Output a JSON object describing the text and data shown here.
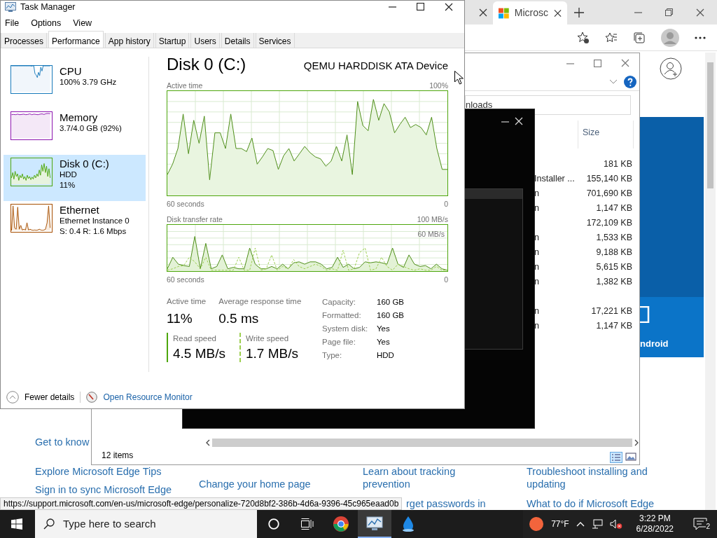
{
  "browser": {
    "tabs": [
      {
        "selected": false
      },
      {
        "title": "Microsc",
        "selected": true
      }
    ],
    "page_links": [
      {
        "lines": [
          "Get to know"
        ]
      },
      {
        "lines": [
          "Explore Microsoft Edge Tips"
        ]
      },
      {
        "lines": [
          "Sign in to sync Microsoft Edge"
        ]
      },
      {
        "lines": [
          "Change your home page"
        ]
      },
      {
        "lines": [
          "Learn about tracking",
          "prevention"
        ]
      },
      {
        "lines": [
          "rget passwords in"
        ]
      },
      {
        "lines": [
          "Troubleshoot installing and",
          "updating"
        ]
      },
      {
        "lines": [
          "What to do if Microsoft Edge"
        ]
      }
    ],
    "promo_text": "ndroid",
    "status_url": "https://support.microsoft.com/en-us/microsoft-edge/personalize-720d8bf2-386b-4d6a-9396-45c965eaad0b"
  },
  "explorer": {
    "address": "nloads",
    "size_header": "Size",
    "rows": [
      {
        "size": "181 KB"
      },
      {
        "name": "Installer ...",
        "size": "155,140 KB"
      },
      {
        "name": "n",
        "size": "701,690 KB"
      },
      {
        "name": "n",
        "size": "1,147 KB"
      },
      {
        "size": "172,109 KB"
      },
      {
        "name": "n",
        "size": "1,533 KB"
      },
      {
        "name": "n",
        "size": "9,188 KB"
      },
      {
        "name": "n",
        "size": "5,615 KB"
      },
      {
        "name": "n",
        "size": "1,382 KB"
      },
      {},
      {
        "name": "n",
        "size": "17,221 KB"
      },
      {
        "name": "n",
        "size": "1,147 KB"
      }
    ],
    "status": "12 items"
  },
  "task_manager": {
    "title": "Task Manager",
    "menu": [
      "File",
      "Options",
      "View"
    ],
    "tabs": [
      {
        "label": "Processes",
        "selected": false
      },
      {
        "label": "Performance",
        "selected": true
      },
      {
        "label": "App history",
        "selected": false
      },
      {
        "label": "Startup",
        "selected": false
      },
      {
        "label": "Users",
        "selected": false
      },
      {
        "label": "Details",
        "selected": false
      },
      {
        "label": "Services",
        "selected": false
      }
    ],
    "resources": [
      {
        "name": "CPU",
        "lines": [
          "100% 3.79 GHz"
        ],
        "color": "#1779ba",
        "selected": false
      },
      {
        "name": "Memory",
        "lines": [
          "3.7/4.0 GB (92%)"
        ],
        "color": "#8b12ae",
        "selected": false
      },
      {
        "name": "Disk 0 (C:)",
        "lines": [
          "HDD",
          "11%"
        ],
        "color": "#4da60c",
        "selected": true
      },
      {
        "name": "Ethernet",
        "lines": [
          "Ethernet Instance 0",
          "S: 0.4 R: 1.6 Mbps"
        ],
        "color": "#a74f01",
        "selected": false
      }
    ],
    "detail": {
      "title": "Disk 0 (C:)",
      "model": "QEMU HARDDISK ATA Device",
      "charts": [
        {
          "label": "Active time",
          "max": "100%",
          "span": "60 seconds",
          "min": "0"
        },
        {
          "label": "Disk transfer rate",
          "max": "100 MB/s",
          "inner_label": "60 MB/s",
          "span": "60 seconds",
          "min": "0"
        }
      ],
      "stats": [
        {
          "label": "Active time",
          "value": "11%"
        },
        {
          "label": "Average response time",
          "value": "0.5 ms"
        }
      ],
      "speeds": [
        {
          "kind": "read",
          "label": "Read speed",
          "value": "4.5 MB/s"
        },
        {
          "kind": "write",
          "label": "Write speed",
          "value": "1.7 MB/s"
        }
      ],
      "properties": [
        {
          "label": "Capacity:",
          "value": "160 GB"
        },
        {
          "label": "Formatted:",
          "value": "160 GB"
        },
        {
          "label": "System disk:",
          "value": "Yes"
        },
        {
          "label": "Page file:",
          "value": "Yes"
        },
        {
          "label": "Type:",
          "value": "HDD"
        }
      ]
    },
    "footer": {
      "fewer": "Fewer details",
      "monitor": "Open Resource Monitor"
    }
  },
  "taskbar": {
    "search_placeholder": "Type here to search",
    "apps": [
      {
        "kind": "chrome",
        "selected": false
      },
      {
        "kind": "task-manager",
        "selected": true
      },
      {
        "kind": "app",
        "selected": false
      }
    ],
    "weather": "77°F",
    "time": "3:22 PM",
    "date": "6/28/2022",
    "notifications": "2"
  }
}
